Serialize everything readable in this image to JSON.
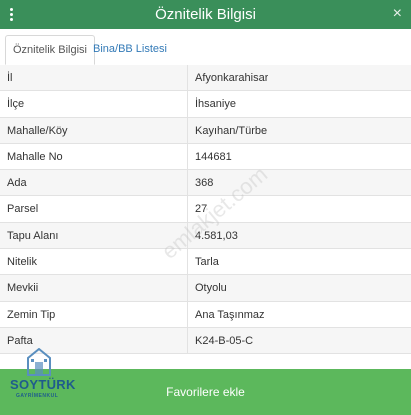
{
  "header": {
    "title": "Öznitelik Bilgisi",
    "close_icon": "×"
  },
  "tabs": [
    {
      "label": "Öznitelik Bilgisi",
      "active": true
    },
    {
      "label": "Bina/BB Listesi",
      "active": false
    }
  ],
  "rows": [
    {
      "label": "İl",
      "value": "Afyonkarahisar"
    },
    {
      "label": "İlçe",
      "value": "İhsaniye"
    },
    {
      "label": "Mahalle/Köy",
      "value": "Kayıhan/Türbe"
    },
    {
      "label": "Mahalle No",
      "value": "144681"
    },
    {
      "label": "Ada",
      "value": "368"
    },
    {
      "label": "Parsel",
      "value": "27"
    },
    {
      "label": "Tapu Alanı",
      "value": "4.581,03"
    },
    {
      "label": "Nitelik",
      "value": "Tarla"
    },
    {
      "label": "Mevkii",
      "value": "Otyolu"
    },
    {
      "label": "Zemin Tip",
      "value": "Ana Taşınmaz"
    },
    {
      "label": "Pafta",
      "value": "K24-B-05-C"
    }
  ],
  "watermark": "emlakjet.com",
  "favorite_button": "Favorilere ekle",
  "logo": {
    "name": "SOYTÜRK",
    "subtitle": "GAYRİMENKUL"
  },
  "colors": {
    "header": "#3a8f5a",
    "button": "#5cb85c",
    "tab_link": "#337ab7",
    "logo": "#1f5c8c"
  }
}
